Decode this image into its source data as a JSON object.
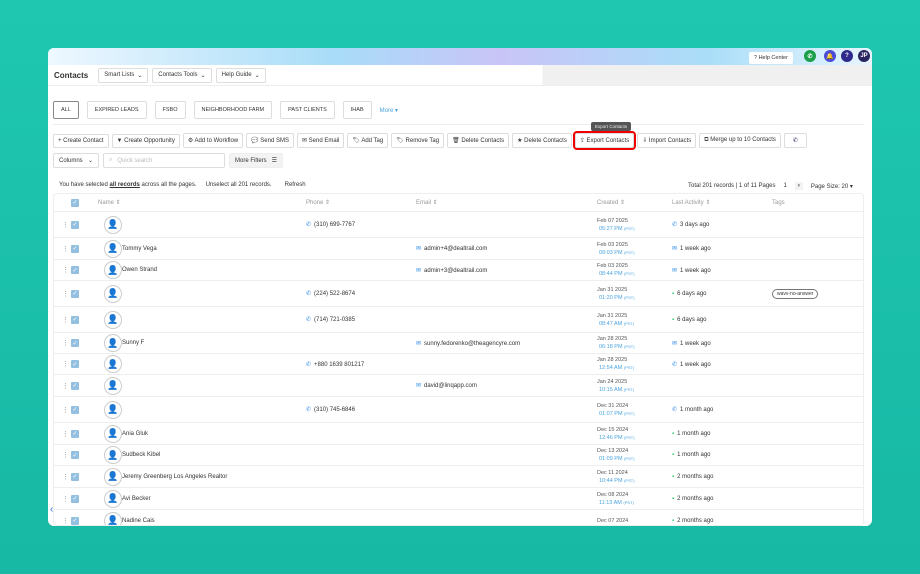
{
  "topbar": {
    "help_center": "? Help Center",
    "avatar_initials": "JP",
    "question": "?"
  },
  "header": {
    "title": "Contacts",
    "smart_lists": "Smart Lists",
    "contacts_tools": "Contacts Tools",
    "help_guide": "Help Guide"
  },
  "lists": [
    "ALL",
    "EXPIRED LEADS",
    "FSBO",
    "NEIGHBORHOOD FARM",
    "PAST CLIENTS",
    "IHAB"
  ],
  "more": "More ▾",
  "actions": [
    "+ Create Contact",
    "▼ Create Opportunity",
    "⚙ Add to Workflow",
    "💬 Send SMS",
    "✉ Send Email",
    "🏷 Add Tag",
    "🏷 Remove Tag",
    "🗑 Delete Contacts",
    "★ Delete Contacts",
    "⇪ Export Contacts",
    "⇩ Import Contacts",
    "⧉ Merge up to 10 Contacts"
  ],
  "tooltip": "Export Contacts",
  "filters": {
    "columns": "Columns",
    "search_placeholder": "Quick search",
    "more_filters": "More Filters"
  },
  "selection": {
    "prefix": "You have selected",
    "all_records": "all records",
    "suffix": "across all the pages.",
    "unselect": "Unselect all 201 records.",
    "refresh": "Refresh"
  },
  "pager": {
    "total": "Total 201 records | 1 of 11 Pages",
    "page": "1",
    "next": "›",
    "page_size": "Page Size: 20 ▾"
  },
  "columns": [
    "Name ⇕",
    "Phone ⇕",
    "Email ⇕",
    "Created ⇕",
    "Last Activity ⇕",
    "Tags"
  ],
  "rows": [
    {
      "name": "",
      "phone": "(310) 699-7767",
      "email": "",
      "date": "Feb 07 2025",
      "time": "05:27 PM",
      "tz": "(PST)",
      "act_icon": "phone",
      "activity": "3 days ago",
      "tag": ""
    },
    {
      "name": "Tommy Vega",
      "phone": "",
      "email": "admin+4@dealtrail.com",
      "date": "Feb 03 2025",
      "time": "09:03 PM",
      "tz": "(PST)",
      "act_icon": "email",
      "activity": "1 week ago",
      "tag": ""
    },
    {
      "name": "Owen Strand",
      "phone": "",
      "email": "admin+3@dealtrail.com",
      "date": "Feb 03 2025",
      "time": "08:44 PM",
      "tz": "(PST)",
      "act_icon": "email",
      "activity": "1 week ago",
      "tag": ""
    },
    {
      "name": "",
      "phone": "(224) 522-8674",
      "email": "",
      "date": "Jan 31 2025",
      "time": "01:20 PM",
      "tz": "(PST)",
      "act_icon": "sms",
      "activity": "6 days ago",
      "tag": "wavv-no-answer"
    },
    {
      "name": "",
      "phone": "(714) 721-0385",
      "email": "",
      "date": "Jan 31 2025",
      "time": "08:47 AM",
      "tz": "(PST)",
      "act_icon": "sms",
      "activity": "6 days ago",
      "tag": ""
    },
    {
      "name": "Sunny F",
      "phone": "",
      "email": "sunny.fedorenko@theagencyre.com",
      "date": "Jan 28 2025",
      "time": "06:18 PM",
      "tz": "(PST)",
      "act_icon": "email",
      "activity": "1 week ago",
      "tag": ""
    },
    {
      "name": "",
      "phone": "+880 1639 801217",
      "email": "",
      "date": "Jan 28 2025",
      "time": "12:54 AM",
      "tz": "(PST)",
      "act_icon": "phone",
      "activity": "1 week ago",
      "tag": ""
    },
    {
      "name": "",
      "phone": "",
      "email": "david@linqapp.com",
      "date": "Jan 24 2025",
      "time": "10:15 AM",
      "tz": "(PST)",
      "act_icon": "",
      "activity": "",
      "tag": ""
    },
    {
      "name": "",
      "phone": "(310) 745-6846",
      "email": "",
      "date": "Dec 31 2024",
      "time": "01:07 PM",
      "tz": "(PST)",
      "act_icon": "phone",
      "activity": "1 month ago",
      "tag": ""
    },
    {
      "name": "Ania Gluk",
      "phone": "",
      "email": "",
      "date": "Dec 15 2024",
      "time": "12:46 PM",
      "tz": "(PST)",
      "act_icon": "sms",
      "activity": "1 month ago",
      "tag": ""
    },
    {
      "name": "Sudbeck Kibel",
      "phone": "",
      "email": "",
      "date": "Dec 13 2024",
      "time": "01:09 PM",
      "tz": "(PST)",
      "act_icon": "sms",
      "activity": "1 month ago",
      "tag": ""
    },
    {
      "name": "Jeremy Greenberg Los Angeles Realtor",
      "phone": "",
      "email": "",
      "date": "Dec 11 2024",
      "time": "10:44 PM",
      "tz": "(PST)",
      "act_icon": "sms",
      "activity": "2 months ago",
      "tag": ""
    },
    {
      "name": "Avi Becker",
      "phone": "",
      "email": "",
      "date": "Dec 08 2024",
      "time": "11:13 AM",
      "tz": "(PST)",
      "act_icon": "sms",
      "activity": "2 months ago",
      "tag": ""
    },
    {
      "name": "Nadine Cais",
      "phone": "",
      "email": "",
      "date": "Dec 07 2024",
      "time": "",
      "tz": "",
      "act_icon": "sms",
      "activity": "2 months ago",
      "tag": ""
    }
  ]
}
